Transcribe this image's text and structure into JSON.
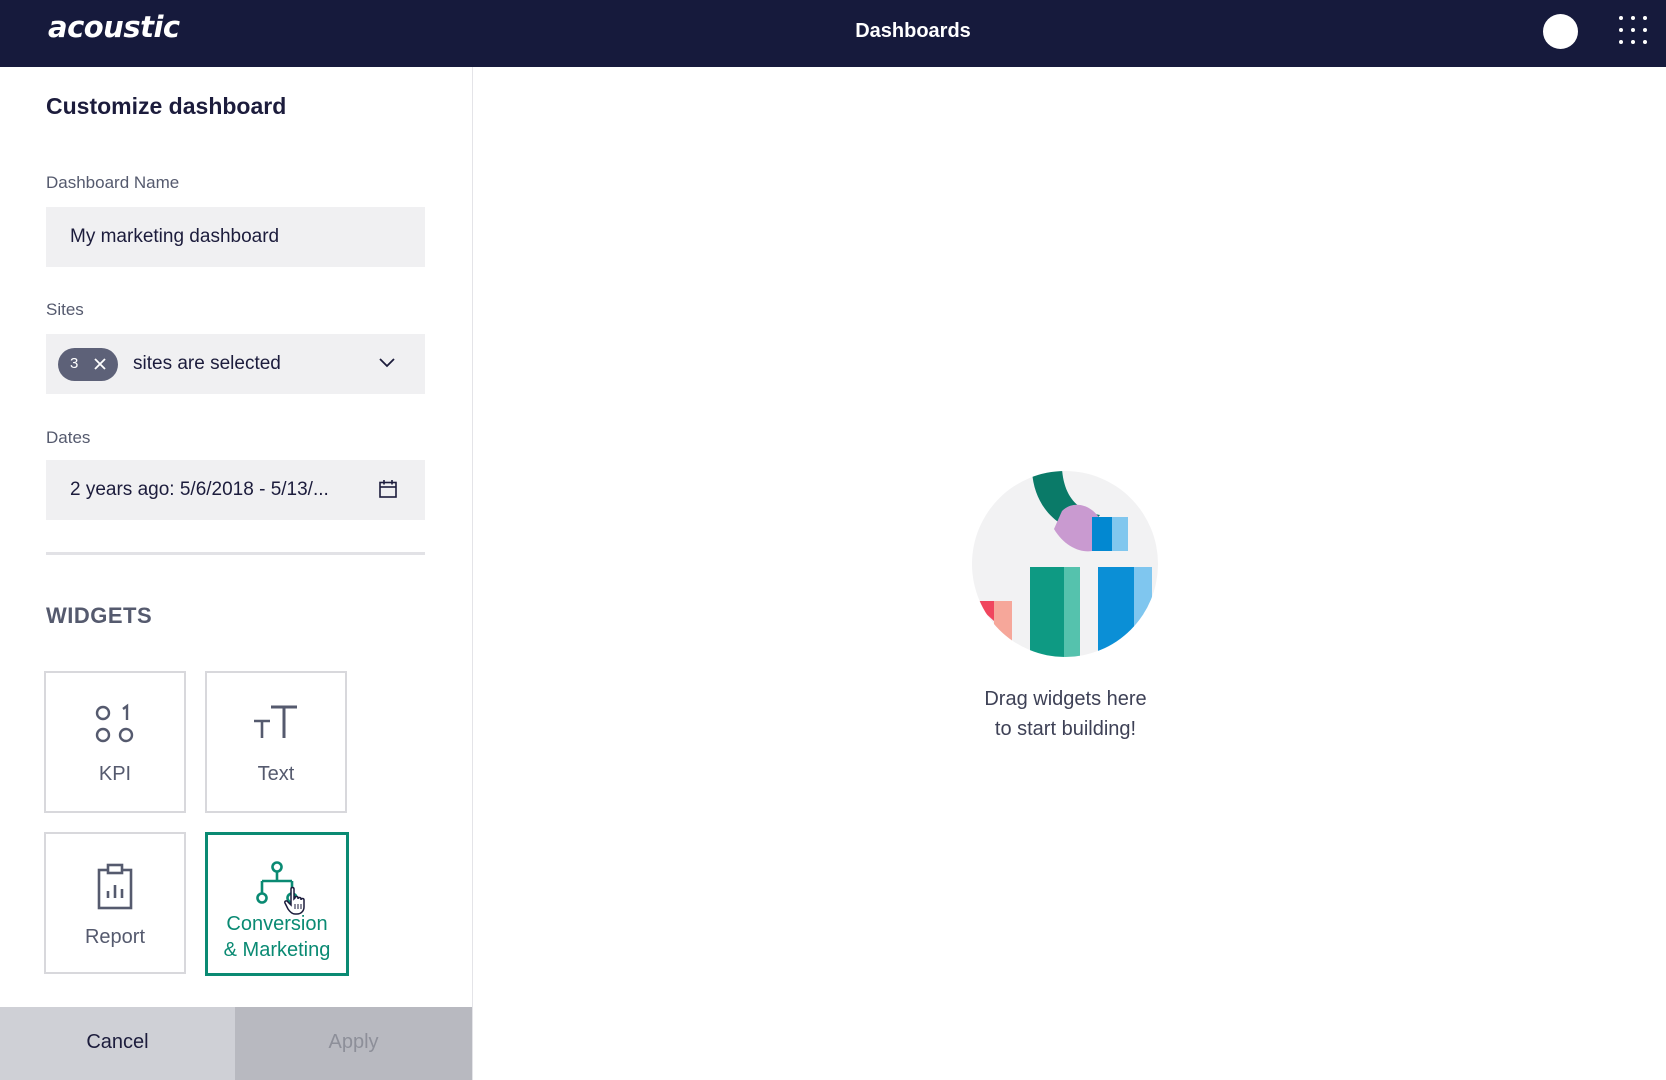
{
  "app": {
    "logo_text": "acoustic",
    "page_title": "Dashboards"
  },
  "header_icons": {
    "avatar": "user-avatar",
    "apps": "apps-grid-icon"
  },
  "panel": {
    "title": "Customize dashboard",
    "dashboard_name": {
      "label": "Dashboard Name",
      "value": "My marketing dashboard"
    },
    "sites": {
      "label": "Sites",
      "count": "3",
      "value": "sites are selected"
    },
    "dates": {
      "label": "Dates",
      "value": "2 years ago: 5/6/2018 - 5/13/..."
    },
    "widgets_heading": "WIDGETS",
    "widgets": [
      {
        "label": "KPI",
        "icon": "kpi-icon"
      },
      {
        "label": "Text",
        "icon": "text-size-icon"
      },
      {
        "label": "Report",
        "icon": "report-clipboard-icon"
      },
      {
        "label_line1": "Conversion",
        "label_line2": "& Marketing",
        "icon": "flow-tree-icon",
        "selected": true
      }
    ],
    "footer": {
      "cancel": "Cancel",
      "apply": "Apply"
    }
  },
  "canvas": {
    "empty_line1": "Drag widgets here",
    "empty_line2": "to start building!"
  },
  "colors": {
    "header_bg": "#161a3c",
    "accent": "#0a8a73",
    "field_bg": "#f0f0f2",
    "chip_bg": "#5d6178"
  }
}
